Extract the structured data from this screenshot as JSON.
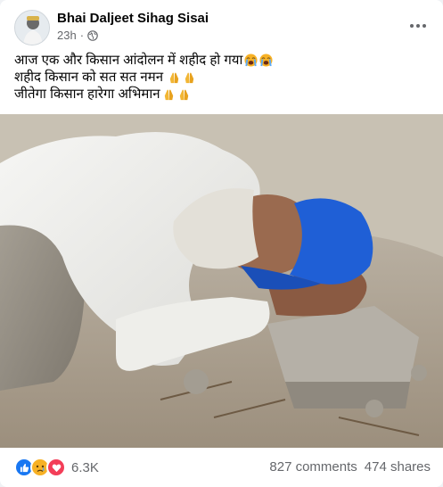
{
  "post": {
    "author": "Bhai Daljeet Sihag Sisai",
    "time": "23h",
    "separator": "·",
    "privacy_icon": "globe-icon",
    "menu_icon": "more-options-icon",
    "caption_lines": [
      "आज एक और किसान आंदोलन में शहीद हो गया",
      "शहीद किसान को सत सत नमन",
      "जीतेगा किसान हारेगा अभिमान"
    ],
    "caption_emojis": [
      "loudly-crying-face-icon",
      "folded-hands-icon",
      "folded-hands-icon"
    ],
    "reaction_icons": [
      "like-icon",
      "sad-icon",
      "love-icon"
    ],
    "reaction_count": "6.3K",
    "comments": "827 comments",
    "shares": "474 shares"
  },
  "colors": {
    "like": "#1877f2",
    "love": "#f33e58",
    "sad": "#f7b125",
    "text_secondary": "#65676b",
    "turban": "#1f5fd6"
  }
}
